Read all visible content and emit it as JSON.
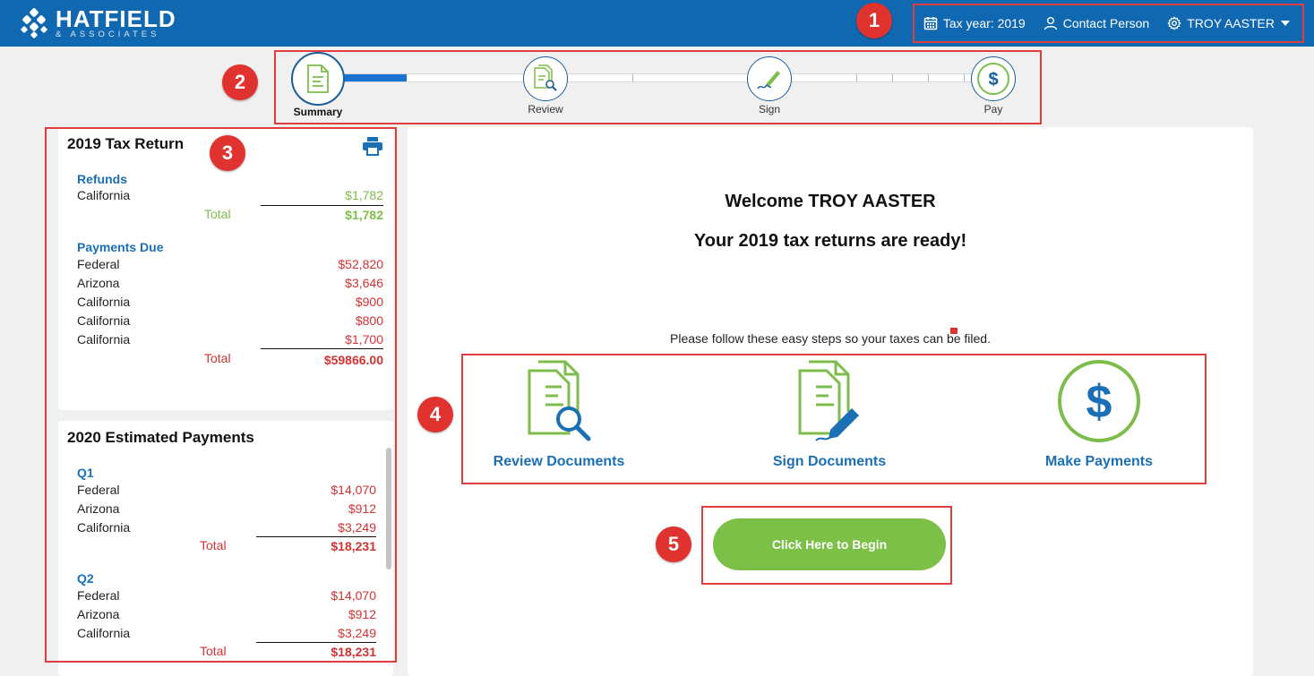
{
  "brand": {
    "name": "HATFIELD",
    "sub": "& ASSOCIATES"
  },
  "header": {
    "tax_year": "Tax year: 2019",
    "contact": "Contact Person",
    "user": "TROY AASTER"
  },
  "callouts": [
    "1",
    "2",
    "3",
    "4",
    "5"
  ],
  "stepper": {
    "progress_fraction": 0.13,
    "steps": [
      {
        "label": "Summary",
        "icon": "document-icon",
        "active": true
      },
      {
        "label": "Review",
        "icon": "document-search-icon",
        "active": false
      },
      {
        "label": "Sign",
        "icon": "pen-sign-icon",
        "active": false
      },
      {
        "label": "Pay",
        "icon": "dollar-icon",
        "active": false
      }
    ]
  },
  "tax_return": {
    "title": "2019 Tax Return",
    "refunds": {
      "title": "Refunds",
      "rows": [
        {
          "label": "California",
          "amount": "$1,782"
        }
      ],
      "total_label": "Total",
      "total": "$1,782"
    },
    "payments_due": {
      "title": "Payments Due",
      "rows": [
        {
          "label": "Federal",
          "amount": "$52,820"
        },
        {
          "label": "Arizona",
          "amount": "$3,646"
        },
        {
          "label": "California",
          "amount": "$900"
        },
        {
          "label": "California",
          "amount": "$800"
        },
        {
          "label": "California",
          "amount": "$1,700"
        }
      ],
      "total_label": "Total",
      "total": "$59866.00"
    }
  },
  "estimated": {
    "title": "2020 Estimated Payments",
    "quarters": [
      {
        "title": "Q1",
        "rows": [
          {
            "label": "Federal",
            "amount": "$14,070"
          },
          {
            "label": "Arizona",
            "amount": "$912"
          },
          {
            "label": "California",
            "amount": "$3,249"
          }
        ],
        "total_label": "Total",
        "total": "$18,231"
      },
      {
        "title": "Q2",
        "rows": [
          {
            "label": "Federal",
            "amount": "$14,070"
          },
          {
            "label": "Arizona",
            "amount": "$912"
          },
          {
            "label": "California",
            "amount": "$3,249"
          }
        ],
        "total_label": "Total",
        "total": "$18,231"
      }
    ]
  },
  "main": {
    "welcome": "Welcome TROY AASTER",
    "ready": "Your 2019 tax returns are ready!",
    "instructions": "Please follow these easy steps so your taxes can be filed.",
    "actions": [
      {
        "label": "Review Documents"
      },
      {
        "label": "Sign Documents"
      },
      {
        "label": "Make Payments"
      }
    ],
    "begin_button": "Click Here to Begin"
  },
  "colors": {
    "header_bg": "#1068b1",
    "accent_blue": "#1b6fb4",
    "progress_blue": "#1a73d3",
    "green": "#7cbd4b",
    "red": "#d23232",
    "callout_red": "#e0332f"
  }
}
